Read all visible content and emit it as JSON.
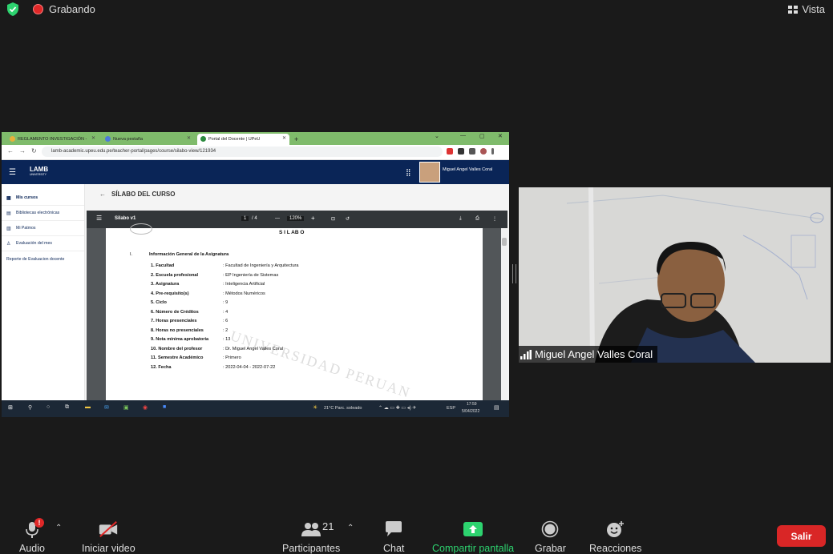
{
  "top_bar": {
    "recording_label": "Grabando",
    "view_label": "Vista"
  },
  "shared_screen": {
    "browser": {
      "tabs": [
        {
          "label": "REGLAMENTO INVESTIGACIÓN -"
        },
        {
          "label": "Nueva pestaña"
        },
        {
          "label": "Portal del Docente | UPeU"
        }
      ],
      "new_tab": "+",
      "url": "lamb-academic.upeu.edu.pe/teacher-portal/pages/course/silabo-view/121934"
    },
    "app": {
      "logo": "LAMB",
      "logo_sub": "UNIVERSITY",
      "user_name": "Miguel Angel Valles Coral",
      "sidebar": [
        {
          "label": "Mis cursos",
          "icon": "grid-icon"
        },
        {
          "label": "Bibliotecas electrónicas",
          "icon": "library-icon"
        },
        {
          "label": "Mi Patmos",
          "icon": "book-icon"
        },
        {
          "label": "Evaluación del mes",
          "icon": "person-icon"
        },
        {
          "label": "Reporte de Evaluacion docente",
          "icon": ""
        }
      ],
      "page_title": "SÍLABO DEL CURSO",
      "pdf": {
        "file_name": "Silabo v1",
        "page_current": "1",
        "page_total": "/ 4",
        "zoom": "120%",
        "doc_heading": "S I L AB O",
        "section_num": "I.",
        "section_title": "Información General de la Asignatura",
        "watermark": "UNIVERSIDAD PERUAN",
        "fields": [
          {
            "label": "1. Facultad",
            "value": ": Facultad de Ingeniería y Arquitectura"
          },
          {
            "label": "2. Escuela profesional",
            "value": ": EP Ingeniería de Sistemas"
          },
          {
            "label": "3. Asignatura",
            "value": ": Inteligencia Artificial"
          },
          {
            "label": "4. Pre-requisito(s)",
            "value": ": Métodos Numéricos"
          },
          {
            "label": "5. Ciclo",
            "value": ": 9"
          },
          {
            "label": "6. Número de Créditos",
            "value": ": 4"
          },
          {
            "label": "7. Horas presenciales",
            "value": ": 6"
          },
          {
            "label": "8. Horas no presenciales",
            "value": ": 2"
          },
          {
            "label": "9. Nota mínima aprobatoria",
            "value": ": 13"
          },
          {
            "label": "10. Nombre del profesor",
            "value": ": Dr. Miguel Angel Valles Coral"
          },
          {
            "label": "11. Semestre Académico",
            "value": ": Primero"
          },
          {
            "label": "12. Fecha",
            "value": ": 2022-04-04 - 2022-07-22"
          }
        ]
      }
    },
    "taskbar": {
      "weather": "21°C  Parc. soleado",
      "lang": "ESP",
      "time": "17:59",
      "date": "5/04/2022"
    }
  },
  "webcam": {
    "participant_name": "Miguel Angel Valles Coral"
  },
  "controls": {
    "audio": "Audio",
    "video": "Iniciar video",
    "participants": "Participantes",
    "participants_count": "21",
    "chat": "Chat",
    "share": "Compartir pantalla",
    "record": "Grabar",
    "reactions": "Reacciones",
    "leave": "Salir",
    "audio_alert": "!"
  },
  "colors": {
    "accent_green": "#2dd36f",
    "leave_red": "#d92626",
    "browser_tab_bar": "#7fbb6b",
    "app_header": "#0a2557"
  }
}
